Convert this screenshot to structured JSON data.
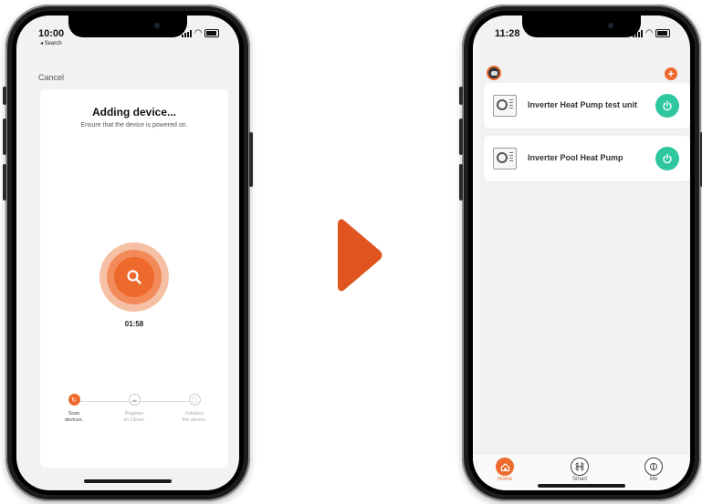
{
  "left_phone": {
    "status_time": "10:00",
    "back_label": "◂ Search",
    "cancel_label": "Cancel",
    "title": "Adding device...",
    "subtitle": "Ensure that the device is powered on.",
    "timer": "01:58",
    "steps": [
      {
        "label": "Scan\ndevices.",
        "state": "active"
      },
      {
        "label": "Register\non Cloud.",
        "state": "pending"
      },
      {
        "label": "Initialize\nthe device.",
        "state": "pending"
      }
    ]
  },
  "right_phone": {
    "status_time": "11:28",
    "devices": [
      {
        "name": "Inverter Heat Pump test unit"
      },
      {
        "name": "Inverter Pool Heat Pump"
      }
    ],
    "tabs": [
      {
        "label": "Home",
        "icon": "home-icon",
        "active": true
      },
      {
        "label": "Smart",
        "icon": "smart-icon",
        "active": false
      },
      {
        "label": "Me",
        "icon": "me-icon",
        "active": false
      }
    ]
  },
  "colors": {
    "accent": "#ee6a2c",
    "power_on": "#2ec79f",
    "arrow": "#e0541f"
  }
}
